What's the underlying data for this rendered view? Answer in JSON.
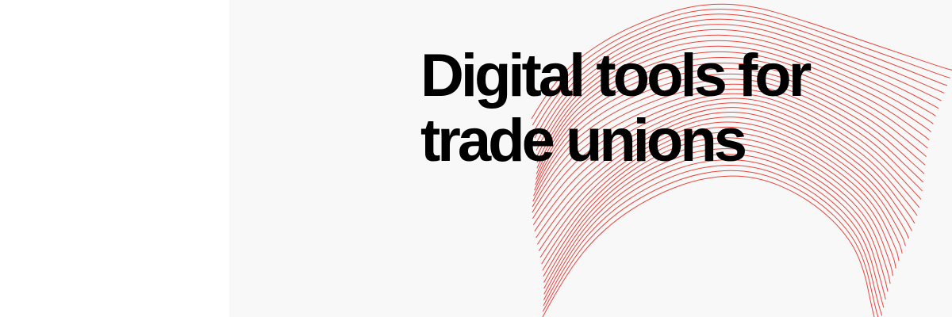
{
  "headline": {
    "line1": "Digital tools for",
    "line2": "trade unions"
  },
  "colors": {
    "panel_background": "#f8f8f8",
    "page_background": "#ffffff",
    "wave_lines": "#e8443a",
    "text": "#000000"
  },
  "decoration": {
    "icon": "contour-wave-lines"
  }
}
